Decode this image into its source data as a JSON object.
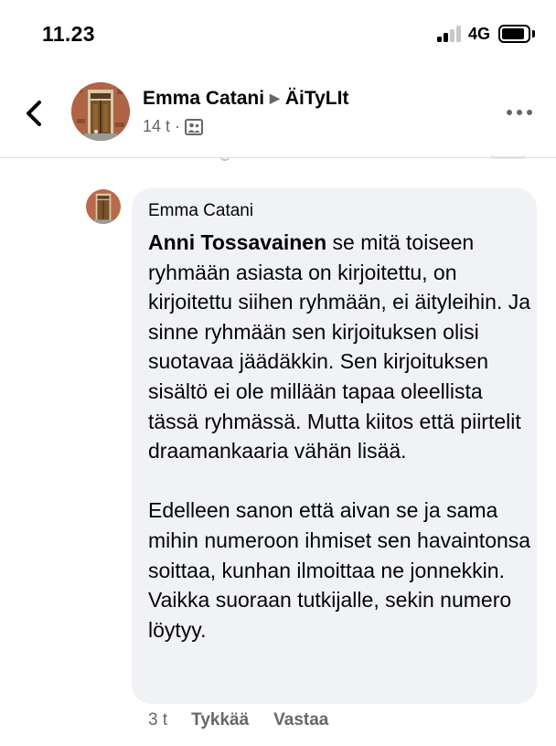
{
  "status_bar": {
    "time": "11.23",
    "network": "4G"
  },
  "post": {
    "author": "Emma Catani",
    "group": "ÄiTyLIt",
    "time": "14 t",
    "separator": "·",
    "audience_icon": "group-audience-icon"
  },
  "comment": {
    "author": "Emma Catani",
    "mention": "Anni Tossavainen",
    "paragraph1": " se mitä toiseen ryhmään asiasta on kirjoitettu, on kirjoitettu siihen ryhmään, ei äityleihin. Ja sinne ryhmään sen kirjoituksen olisi suotavaa jäädäkkin. Sen kirjoituksen sisältö ei ole millään tapaa oleellista tässä ryhmässä. Mutta kiitos että piirtelit draamankaaria vähän lisää.",
    "paragraph2": "Edelleen sanon että aivan se ja sama mihin numeroon ihmiset sen havaintonsa soittaa, kunhan ilmoittaa ne jonnekkin. Vaikka suoraan tutkijalle, sekin numero löytyy.",
    "time": "3 t",
    "like_label": "Tykkää",
    "reply_label": "Vastaa"
  },
  "colors": {
    "bubble": "#f0f2f5",
    "secondary_text": "#65676b",
    "primary_text": "#050505"
  }
}
